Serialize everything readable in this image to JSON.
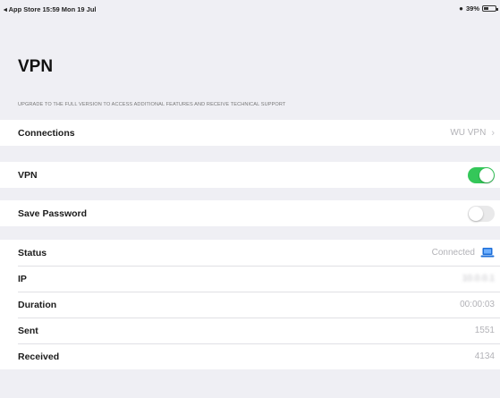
{
  "status_bar": {
    "left": "◂ App Store  15:59  Mon 19 Jul",
    "battery": "39%"
  },
  "page": {
    "title": "VPN",
    "upgrade_note": "UPGRADE TO THE FULL VERSION TO ACCESS ADDITIONAL FEATURES AND RECEIVE TECHNICAL SUPPORT"
  },
  "connections": {
    "label": "Connections",
    "value": "WU VPN"
  },
  "vpn": {
    "label": "VPN",
    "enabled": true
  },
  "save_password": {
    "label": "Save Password",
    "enabled": false
  },
  "info": {
    "status_label": "Status",
    "status_value": "Connected",
    "ip_label": "IP",
    "ip_value": "10.0.0.1",
    "duration_label": "Duration",
    "duration_value": "00:00:03",
    "sent_label": "Sent",
    "sent_value": "1551",
    "received_label": "Received",
    "received_value": "4134"
  },
  "colors": {
    "toggle_on": "#34c759",
    "accent": "#1e6fd9",
    "background": "#efeff4"
  },
  "icons": {
    "status": "laptop-icon",
    "wifi": "wifi-icon",
    "battery": "battery-icon",
    "disclosure": "chevron-right-icon"
  }
}
